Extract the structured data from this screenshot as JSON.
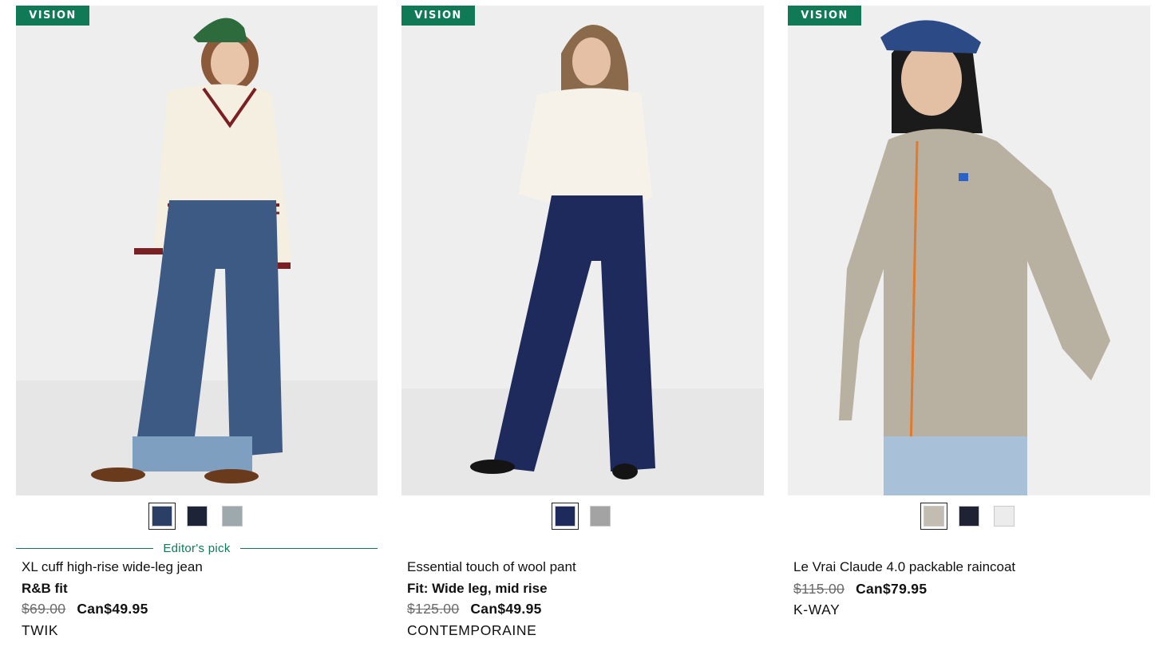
{
  "products": [
    {
      "badge": "VISION",
      "image_label": "model-wearing-wide-leg-jeans",
      "swatches": [
        {
          "color": "#2b3f66",
          "selected": true
        },
        {
          "color": "#1d2437",
          "selected": false
        },
        {
          "color": "#9ea9ad",
          "selected": false
        }
      ],
      "editor_pick": "Editor's pick",
      "name": "XL cuff high-rise wide-leg jean",
      "fit": "R&B fit",
      "old_price": "$69.00",
      "price": "Can$49.95",
      "brand": "TWIK"
    },
    {
      "badge": "VISION",
      "image_label": "model-wearing-wool-pant",
      "swatches": [
        {
          "color": "#1f2a5c",
          "selected": true
        },
        {
          "color": "#a3a3a3",
          "selected": false
        }
      ],
      "name": "Essential touch of wool pant",
      "fit": "Fit: Wide leg, mid rise",
      "old_price": "$125.00",
      "price": "Can$49.95",
      "brand": "CONTEMPORAINE"
    },
    {
      "badge": "VISION",
      "image_label": "model-wearing-packable-raincoat",
      "swatches": [
        {
          "color": "#c3bcb0",
          "selected": true
        },
        {
          "color": "#1e2233",
          "selected": false
        },
        {
          "color": "#ececec",
          "selected": false
        }
      ],
      "name": "Le Vrai Claude 4.0 packable raincoat",
      "old_price": "$115.00",
      "price": "Can$79.95",
      "brand": "K-WAY"
    }
  ],
  "colors": {
    "badge_green": "#0f7a55",
    "editor_green": "#0f7a55",
    "strike_grey": "#6b6b6b"
  }
}
